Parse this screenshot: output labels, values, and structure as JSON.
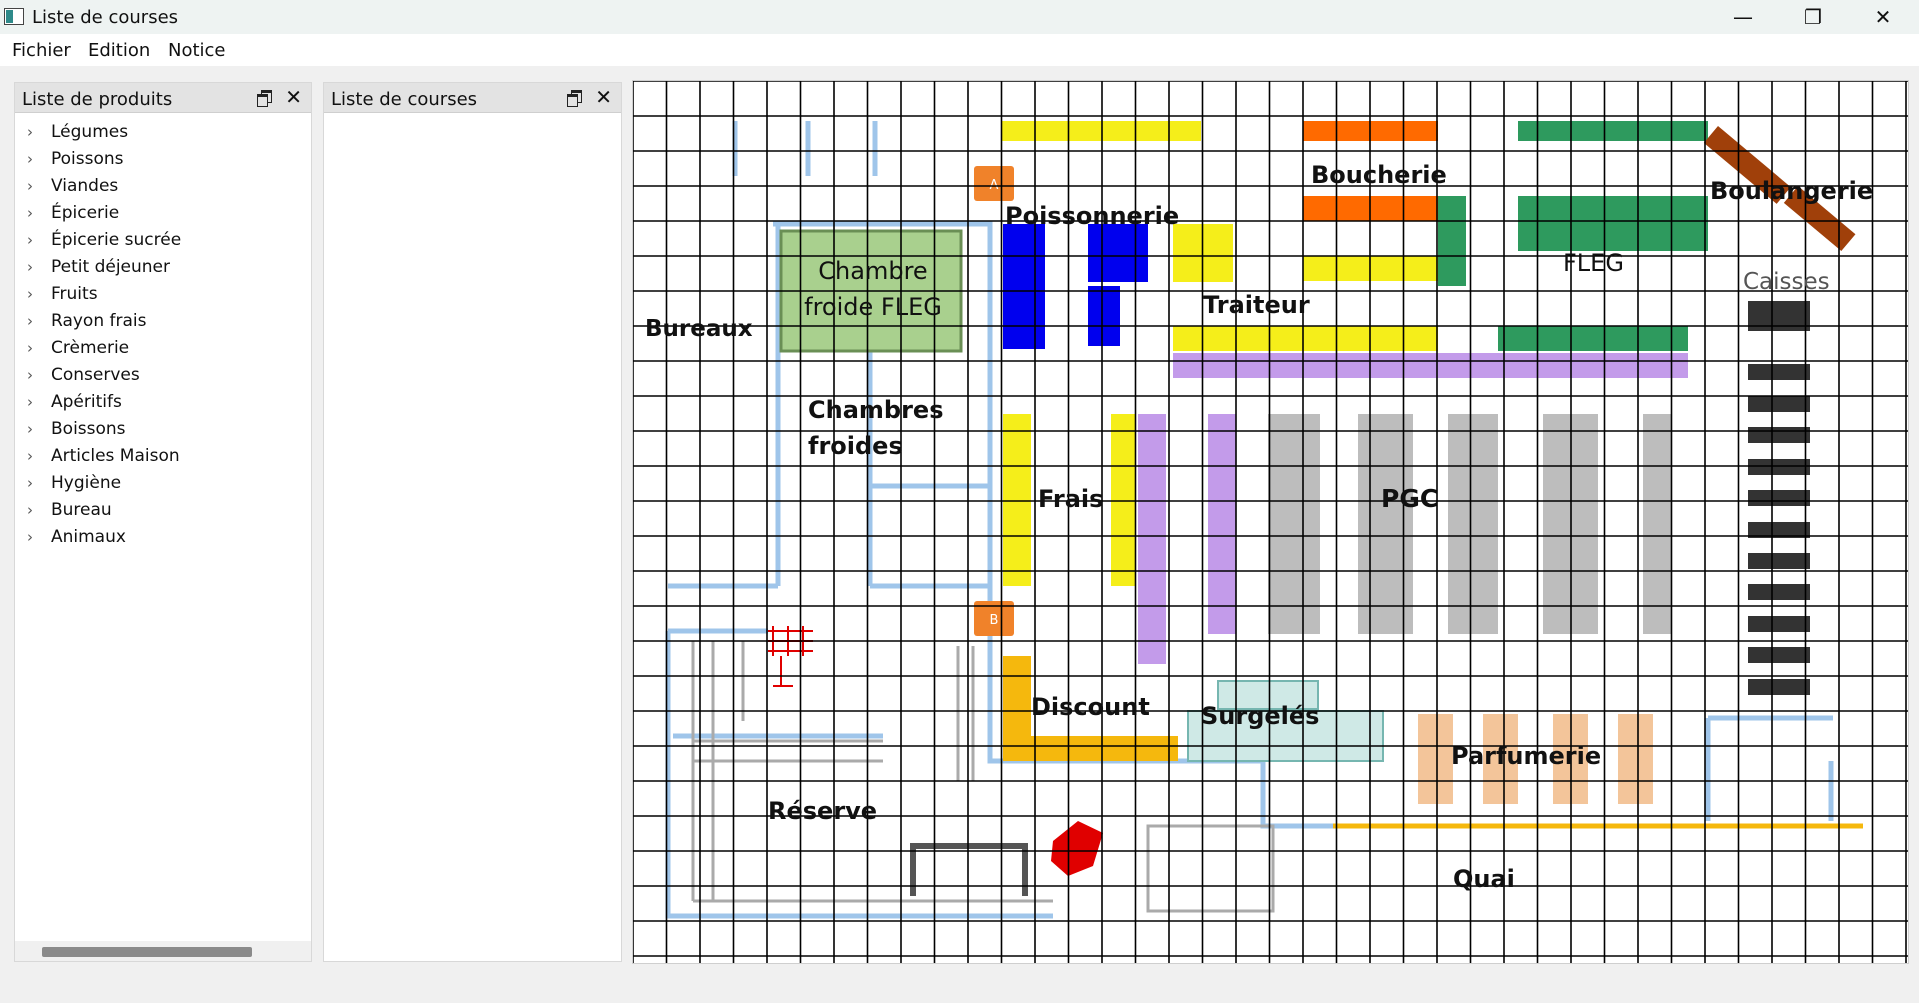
{
  "window": {
    "title": "Liste de courses",
    "minimize_icon": "minimize-icon",
    "maximize_icon": "restore-icon",
    "close_icon": "close-icon",
    "minimize_glyph": "—",
    "restore_glyph": "❐",
    "close_glyph": "✕"
  },
  "menubar": {
    "items": [
      "Fichier",
      "Edition",
      "Notice"
    ]
  },
  "products_panel": {
    "title": "Liste de produits",
    "categories": [
      "Légumes",
      "Poissons",
      "Viandes",
      "Épicerie",
      "Épicerie sucrée",
      "Petit déjeuner",
      "Fruits",
      "Rayon frais",
      "Crèmerie",
      "Conserves",
      "Apéritifs",
      "Boissons",
      "Articles Maison",
      "Hygiène",
      "Bureau",
      "Animaux"
    ],
    "expand_glyph": "›"
  },
  "shopping_panel": {
    "title": "Liste de courses",
    "items": []
  },
  "map": {
    "labels": {
      "bureaux": "Bureaux",
      "chambre_froide_fleg_1": "Chambre",
      "chambre_froide_fleg_2": "froide FLEG",
      "poissonnerie": "Poissonnerie",
      "boucherie": "Boucherie",
      "boulangerie": "Boulangerie",
      "fleg": "FLEG",
      "caisses": "Caisses",
      "traiteur": "Traiteur",
      "chambres_froides_1": "Chambres",
      "chambres_froides_2": "froides",
      "frais": "Frais",
      "pgc": "PGC",
      "discount": "Discount",
      "surgeles": "Surgelés",
      "parfumerie": "Parfumerie",
      "reserve": "Réserve",
      "quai": "Quai",
      "marker_a": "A",
      "marker_b": "B"
    },
    "colors": {
      "grid": "#000000",
      "walls": "#9fc5ea",
      "fleg_room": "#a9d08e",
      "poissonnerie": "#0000ee",
      "traiteur": "#f5ee1a",
      "boucherie": "#ff6a00",
      "fleg": "#2e9a5e",
      "boulangerie": "#a0400a",
      "caisses": "#333333",
      "pgc": "#bdbdbd",
      "lavender": "#c39bea",
      "discount": "#f5b80d",
      "parfumerie": "#f3c59a",
      "quai_line": "#f5b80d",
      "markers": "#f0822a",
      "extinguisher": "#e00000"
    }
  }
}
